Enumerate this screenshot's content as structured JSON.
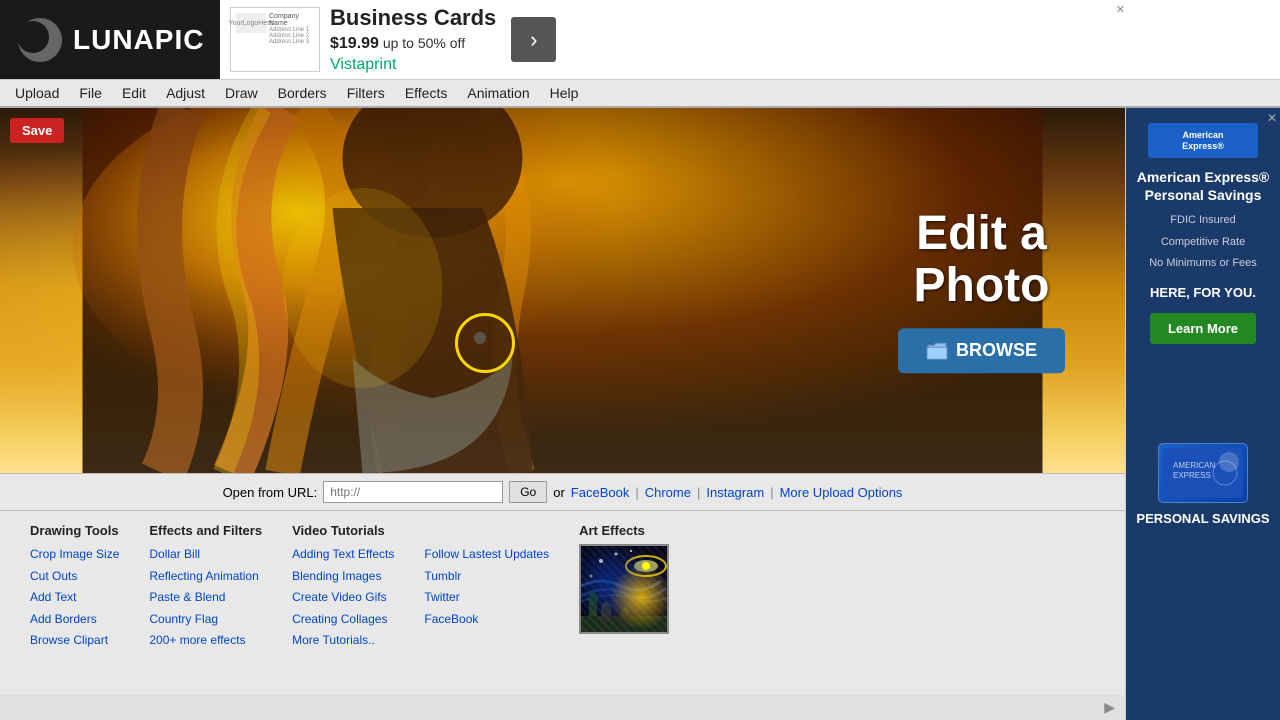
{
  "logo": {
    "text": "LUNAPIC"
  },
  "topAd": {
    "logo_line1": "Your",
    "logo_line2": "Logo",
    "logo_line3": "Here",
    "company_name": "Company Name",
    "address_lines": "Address Line 1\nAddress Line 2\nAddress Line 3",
    "title": "Business Cards",
    "price": "$19.99",
    "discount": "up to 50% off",
    "brand": "Vistaprint",
    "arrow": "›",
    "close": "✕"
  },
  "navbar": {
    "items": [
      "Upload",
      "File",
      "Edit",
      "Adjust",
      "Draw",
      "Borders",
      "Filters",
      "Effects",
      "Animation",
      "Help"
    ]
  },
  "hero": {
    "title_line1": "Edit a",
    "title_line2": "Photo",
    "browse_label": "BROWSE",
    "save_label": "Save"
  },
  "urlBar": {
    "label": "Open from URL:",
    "placeholder": "http://",
    "go_label": "Go",
    "or_text": "or",
    "links": [
      "FaceBook",
      "Chrome",
      "Instagram",
      "More Upload Options"
    ],
    "separators": [
      "|",
      "|",
      "|"
    ]
  },
  "footer": {
    "col1": {
      "heading": "Drawing Tools",
      "links": [
        "Crop Image Size",
        "Cut Outs",
        "Add Text",
        "Add Borders",
        "Browse Clipart"
      ]
    },
    "col2": {
      "heading": "Effects and Filters",
      "links": [
        "Dollar Bill",
        "Reflecting Animation",
        "Paste & Blend",
        "Country Flag",
        "200+ more effects"
      ]
    },
    "col3": {
      "heading": "Video Tutorials",
      "links": [
        "Adding Text Effects",
        "Blending Images",
        "Create Video Gifs",
        "Creating Collages",
        "More Tutorials.."
      ]
    },
    "col4": {
      "links": [
        "Follow Lastest Updates",
        "Tumblr",
        "Twitter",
        "FaceBook"
      ]
    },
    "artEffects": {
      "heading": "Art Effects"
    }
  },
  "rightAd1": {
    "brand": "American Express®",
    "product": "Personal Savings",
    "feature1": "FDIC Insured",
    "feature2": "Competitive Rate",
    "feature3": "No Minimums or Fees",
    "tagline": "HERE, FOR YOU.",
    "cta": "Learn More"
  },
  "rightAd2": {
    "card_text": "AMERICAN EXPRESS",
    "label": "PERSONAL SAVINGS"
  }
}
